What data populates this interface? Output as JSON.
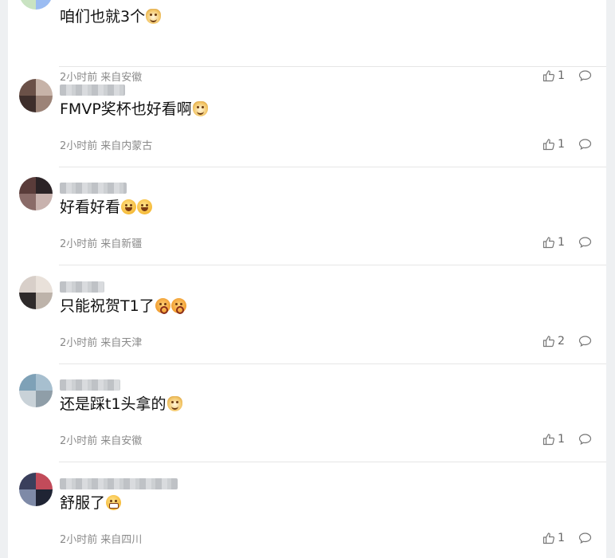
{
  "comments": [
    {
      "text": "咱们也就3个",
      "emojis": [
        "dog"
      ],
      "time": "2小时前",
      "source": "来自安徽",
      "likes": "1",
      "avatar_colors": [
        "#b9d8b1",
        "#7aa7e8",
        "#c9e3c2",
        "#9bbcf2"
      ],
      "username_masked": true
    },
    {
      "text": "FMVP奖杯也好看啊",
      "emojis": [
        "dog"
      ],
      "time": "2小时前",
      "source": "来自内蒙古",
      "likes": "1",
      "avatar_colors": [
        "#6b5148",
        "#c7b3a8",
        "#3e2e2b",
        "#9c8377"
      ],
      "username_masked": true
    },
    {
      "text": "好看好看",
      "emojis": [
        "laugh",
        "laugh"
      ],
      "time": "2小时前",
      "source": "来自新疆",
      "likes": "1",
      "avatar_colors": [
        "#5a3c3a",
        "#2b2326",
        "#8a6b68",
        "#c8b2ae"
      ],
      "username_masked": true
    },
    {
      "text": "只能祝贺T1了",
      "emojis": [
        "blush",
        "blush"
      ],
      "time": "2小时前",
      "source": "来自天津",
      "likes": "2",
      "avatar_colors": [
        "#d8cfc9",
        "#e9e1da",
        "#2e2a2a",
        "#bdb3aa"
      ],
      "username_masked": true
    },
    {
      "text": "还是踩t1头拿的",
      "emojis": [
        "dog"
      ],
      "time": "2小时前",
      "source": "来自安徽",
      "likes": "1",
      "avatar_colors": [
        "#7ea1b7",
        "#a7bfcf",
        "#c9d2d8",
        "#8f9ea8"
      ],
      "username_masked": true
    },
    {
      "text": "舒服了",
      "emojis": [
        "grin"
      ],
      "time": "2小时前",
      "source": "来自四川",
      "likes": "1",
      "avatar_colors": [
        "#3a3f5c",
        "#c24b5a",
        "#7e8aa7",
        "#1f2434"
      ],
      "username_masked": true
    }
  ],
  "icons": {
    "like": "thumbs-up-icon",
    "reply": "comment-bubble-icon"
  },
  "colors": {
    "meta_text": "#8a8a8a",
    "body_text": "#111111",
    "divider": "#e6e6e6"
  }
}
